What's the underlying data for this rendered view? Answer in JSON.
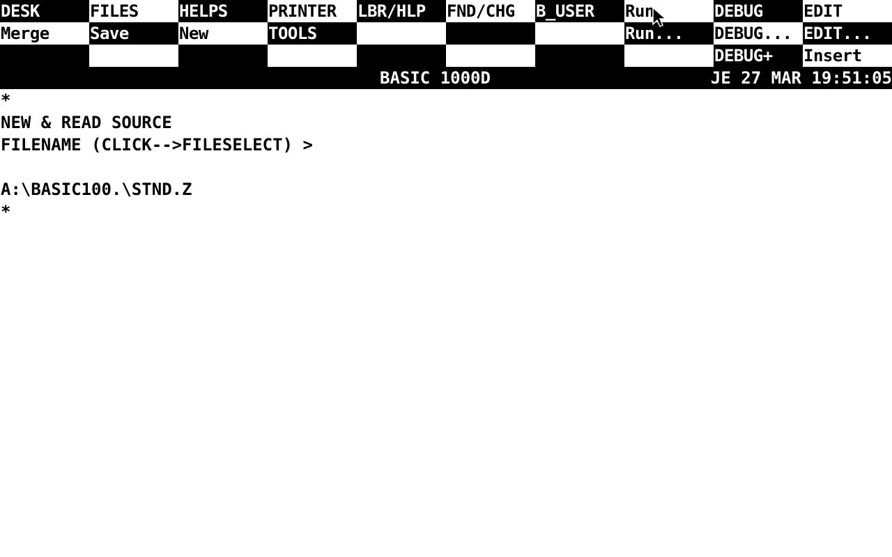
{
  "menu": {
    "row1": [
      {
        "label": "DESK",
        "name": "menu-desk"
      },
      {
        "label": "FILES",
        "name": "menu-files"
      },
      {
        "label": "HELPS",
        "name": "menu-helps"
      },
      {
        "label": "PRINTER",
        "name": "menu-printer"
      },
      {
        "label": "LBR/HLP",
        "name": "menu-lbr-hlp"
      },
      {
        "label": "FND/CHG",
        "name": "menu-fnd-chg"
      },
      {
        "label": "B_USER",
        "name": "menu-b-user"
      },
      {
        "label": "Run",
        "name": "menu-run"
      },
      {
        "label": "DEBUG",
        "name": "menu-debug"
      },
      {
        "label": "EDIT",
        "name": "menu-edit"
      }
    ],
    "row2": [
      {
        "label": "Merge",
        "name": "menu-merge"
      },
      {
        "label": "Save",
        "name": "menu-save"
      },
      {
        "label": "New",
        "name": "menu-new"
      },
      {
        "label": "TOOLS",
        "name": "menu-tools"
      },
      {
        "label": "",
        "name": "menu-empty-r2-5"
      },
      {
        "label": "",
        "name": "menu-empty-r2-6"
      },
      {
        "label": "",
        "name": "menu-empty-r2-7"
      },
      {
        "label": "Run...",
        "name": "menu-run-dialog"
      },
      {
        "label": "DEBUG...",
        "name": "menu-debug-dialog"
      },
      {
        "label": "EDIT...",
        "name": "menu-edit-dialog"
      }
    ],
    "row3": [
      {
        "label": "",
        "name": "menu-empty-r3-1"
      },
      {
        "label": "",
        "name": "menu-empty-r3-2"
      },
      {
        "label": "",
        "name": "menu-empty-r3-3"
      },
      {
        "label": "",
        "name": "menu-empty-r3-4"
      },
      {
        "label": "",
        "name": "menu-empty-r3-5"
      },
      {
        "label": "",
        "name": "menu-empty-r3-6"
      },
      {
        "label": "",
        "name": "menu-empty-r3-7"
      },
      {
        "label": "",
        "name": "menu-empty-r3-8"
      },
      {
        "label": "DEBUG+",
        "name": "menu-debug-plus"
      },
      {
        "label": "Insert",
        "name": "menu-insert"
      }
    ]
  },
  "status": {
    "title": "BASIC 1000D",
    "datetime": "JE 27 MAR 19:51:05"
  },
  "console": {
    "lines": [
      "*",
      "NEW & READ SOURCE",
      "FILENAME (CLICK-->FILESELECT) >",
      "",
      "A:\\BASIC100.\\STND.Z",
      "*"
    ]
  },
  "colors": {
    "dark": "#000000",
    "light": "#ffffff"
  },
  "pointer": {
    "icon": "mouse-pointer-icon"
  }
}
